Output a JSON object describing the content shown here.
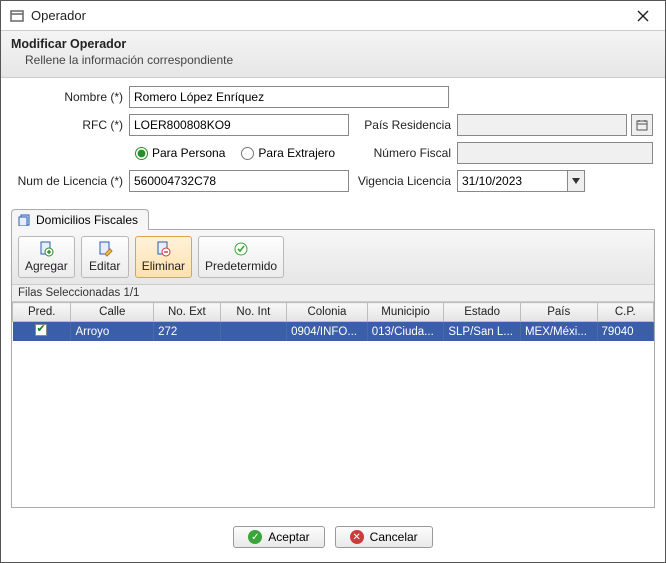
{
  "window": {
    "title": "Operador"
  },
  "header": {
    "title": "Modificar Operador",
    "subtitle": "Rellene la información correspondiente"
  },
  "form": {
    "nombre_label": "Nombre (*)",
    "nombre_value": "Romero López Enríquez",
    "rfc_label": "RFC (*)",
    "rfc_value": "LOER800808KO9",
    "radio_persona": "Para Persona",
    "radio_extranjero": "Para Extrajero",
    "licencia_label": "Num de Licencia (*)",
    "licencia_value": "560004732C78",
    "pais_label": "País Residencia",
    "pais_value": "",
    "fiscal_label": "Número Fiscal",
    "fiscal_value": "",
    "vigencia_label": "Vigencia Licencia",
    "vigencia_value": "31/10/2023"
  },
  "tabs": {
    "domicilios": "Domicilios Fiscales"
  },
  "toolbar": {
    "agregar": "Agregar",
    "editar": "Editar",
    "eliminar": "Eliminar",
    "predet": "Predetermido"
  },
  "grid": {
    "selinfo": "Filas Seleccionadas 1/1",
    "headers": {
      "pred": "Pred.",
      "calle": "Calle",
      "noext": "No. Ext",
      "noint": "No. Int",
      "colonia": "Colonia",
      "municipio": "Municipio",
      "estado": "Estado",
      "pais": "País",
      "cp": "C.P."
    },
    "rows": [
      {
        "pred": true,
        "calle": "Arroyo",
        "noext": "272",
        "noint": "",
        "colonia": "0904/INFO...",
        "municipio": "013/Ciuda...",
        "estado": "SLP/San L...",
        "pais": "MEX/Méxi...",
        "cp": "79040"
      }
    ]
  },
  "footer": {
    "aceptar": "Aceptar",
    "cancelar": "Cancelar"
  }
}
